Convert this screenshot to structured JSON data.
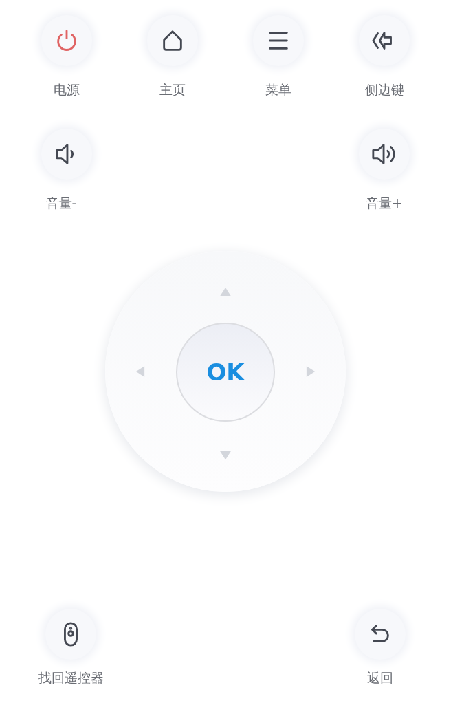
{
  "top_buttons": [
    {
      "kind": "power",
      "label": "电源"
    },
    {
      "kind": "home",
      "label": "主页"
    },
    {
      "kind": "menu",
      "label": "菜单"
    },
    {
      "kind": "side",
      "label": "侧边键"
    }
  ],
  "volume_buttons": [
    {
      "kind": "volume_down",
      "label": "音量-"
    },
    {
      "kind": "volume_up",
      "label": "音量+"
    }
  ],
  "dpad": {
    "ok_label": "OK"
  },
  "bottom_buttons": [
    {
      "kind": "find_remote",
      "label": "找回遥控器"
    },
    {
      "kind": "back",
      "label": "返回"
    }
  ]
}
